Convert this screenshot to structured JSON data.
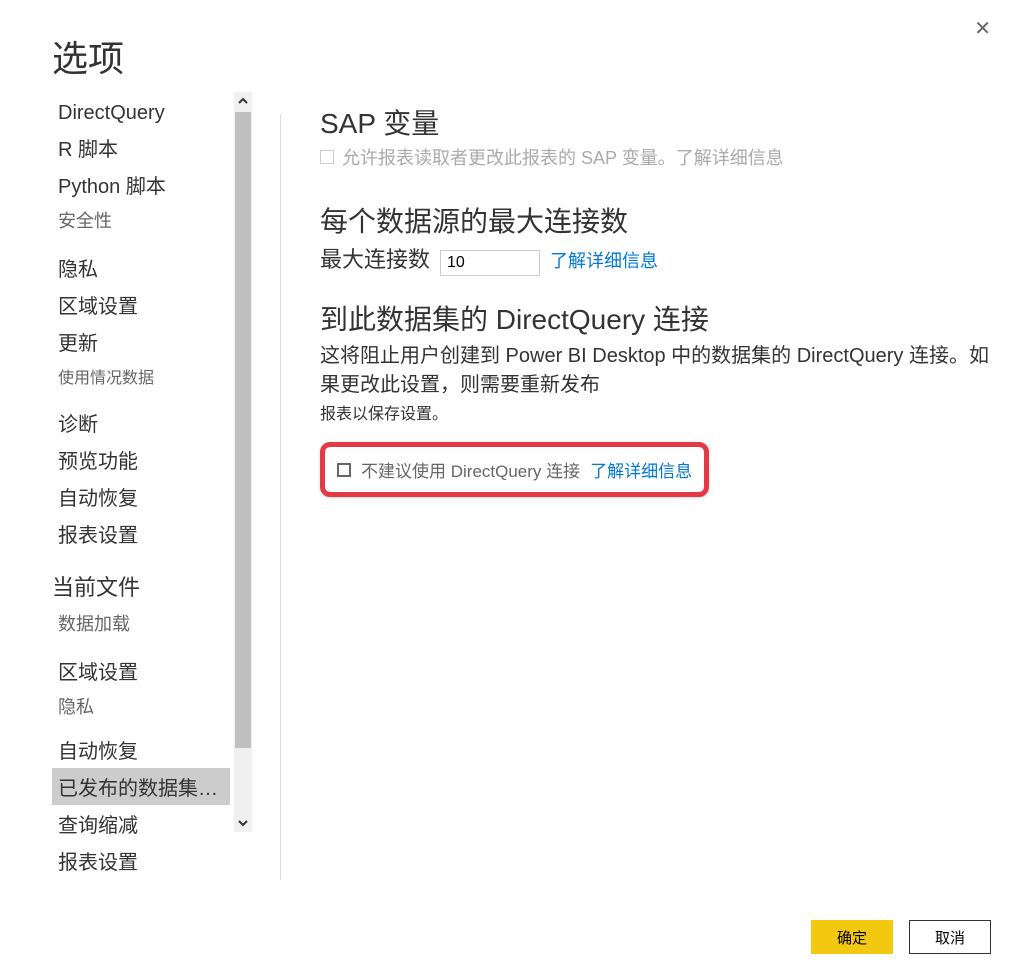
{
  "dialog": {
    "title": "选项",
    "closeLabel": "✕"
  },
  "sidebar": {
    "items": [
      {
        "label": "DirectQuery",
        "type": "item"
      },
      {
        "label": "R 脚本",
        "type": "item"
      },
      {
        "label": "Python 脚本",
        "type": "item"
      },
      {
        "label": "安全性",
        "type": "sub"
      },
      {
        "label": "隐私",
        "type": "item"
      },
      {
        "label": "区域设置",
        "type": "item"
      },
      {
        "label": "更新",
        "type": "item"
      },
      {
        "label": "使用情况数据",
        "type": "sub"
      },
      {
        "label": "诊断",
        "type": "item"
      },
      {
        "label": "预览功能",
        "type": "item"
      },
      {
        "label": "自动恢复",
        "type": "item"
      },
      {
        "label": "报表设置",
        "type": "item"
      }
    ],
    "sectionHeading": "当前文件",
    "items2": [
      {
        "label": "数据加载",
        "type": "sub"
      },
      {
        "label": "区域设置",
        "type": "item"
      },
      {
        "label": "隐私",
        "type": "sub"
      },
      {
        "label": "自动恢复",
        "type": "item"
      },
      {
        "label": "已发布的数据集…",
        "type": "item",
        "selected": true
      },
      {
        "label": "查询缩减",
        "type": "item"
      },
      {
        "label": "报表设置",
        "type": "item"
      }
    ]
  },
  "main": {
    "section1": {
      "heading": "SAP 变量",
      "checkboxLabel": "允许报表读取者更改此报表的 SAP 变量。了解详细信息"
    },
    "section2": {
      "heading": "每个数据源的最大连接数",
      "connLabel": "最大连接数",
      "connValue": "10",
      "learnMore": "了解详细信息"
    },
    "section3": {
      "heading": "到此数据集的 DirectQuery 连接",
      "desc1": "这将阻止用户创建到 Power BI Desktop 中的数据集的 DirectQuery 连接。如果更改此设置，则需要重新发布",
      "desc2": "报表以保存设置。",
      "checkboxLabel": "不建议使用 DirectQuery 连接",
      "learnMore": "了解详细信息"
    }
  },
  "footer": {
    "ok": "确定",
    "cancel": "取消"
  }
}
